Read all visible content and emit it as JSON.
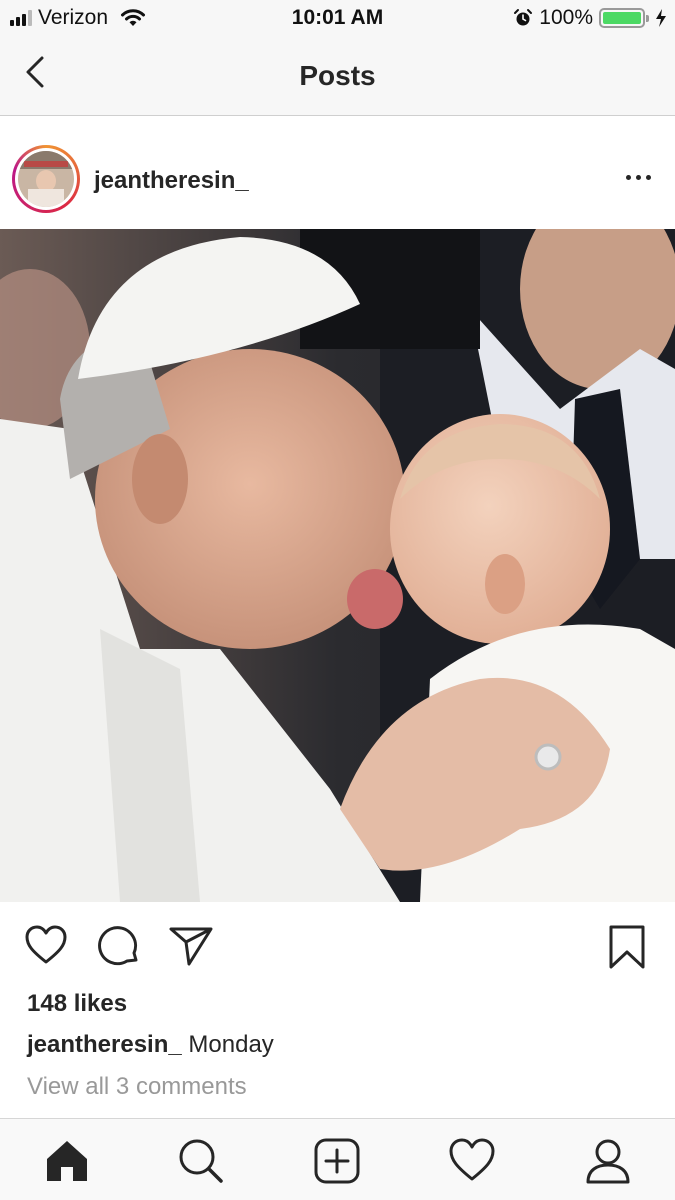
{
  "status_bar": {
    "carrier": "Verizon",
    "time": "10:01 AM",
    "battery_percent": "100%",
    "battery_level": 1.0,
    "signal_icon": "signal-bars-icon",
    "wifi_icon": "wifi-icon",
    "alarm_icon": "alarm-clock-icon",
    "charging_icon": "charging-bolt-icon",
    "battery_color": "#4cd964"
  },
  "nav": {
    "title": "Posts",
    "back_icon": "chevron-left-icon"
  },
  "post": {
    "username": "jeantheresin_",
    "more_icon": "more-horizontal-icon",
    "image_description_icon": "post-photo",
    "likes": "148 likes",
    "caption_user": "jeantheresin_",
    "caption_text": " Monday",
    "view_comments": "View all 3 comments",
    "actions": {
      "like_icon": "heart-icon",
      "comment_icon": "comment-icon",
      "share_icon": "paper-plane-icon",
      "save_icon": "bookmark-icon"
    }
  },
  "tabbar": {
    "items": [
      {
        "icon": "home-icon",
        "active": true
      },
      {
        "icon": "search-icon",
        "active": false
      },
      {
        "icon": "add-post-icon",
        "active": false
      },
      {
        "icon": "activity-heart-icon",
        "active": false
      },
      {
        "icon": "profile-icon",
        "active": false
      }
    ]
  },
  "colors": {
    "text": "#262626",
    "muted": "#999999",
    "story_ring": "#dc2743"
  }
}
